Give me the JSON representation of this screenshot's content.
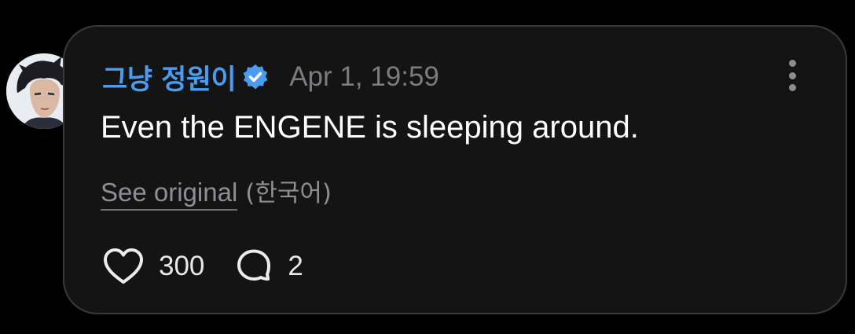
{
  "post": {
    "author": {
      "name": "그냥 정원이",
      "verified": true,
      "avatar_icon": "avatar"
    },
    "timestamp": "Apr 1, 19:59",
    "text": "Even the ENGENE is sleeping around.",
    "translation": {
      "link_label": "See original",
      "language": "(한국어)"
    },
    "stats": {
      "likes": "300",
      "replies": "2"
    },
    "icons": {
      "verified": "verified-badge-icon",
      "more": "more-vertical-icon",
      "like": "heart-icon",
      "reply": "comment-bubble-icon"
    },
    "colors": {
      "background": "#000000",
      "card": "#141414",
      "card_border": "#3a3a3c",
      "author": "#4a9cf0",
      "muted": "#8e8e93",
      "text": "#ffffff"
    }
  }
}
